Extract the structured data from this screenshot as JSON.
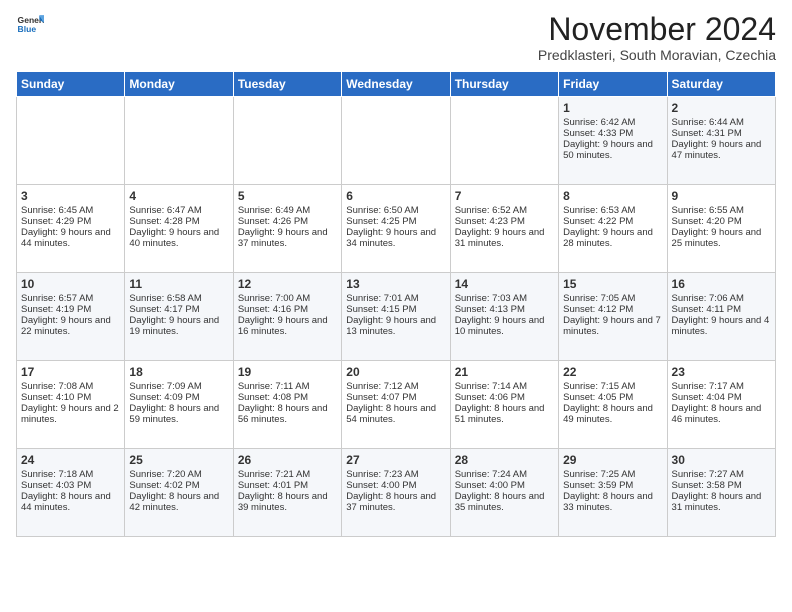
{
  "header": {
    "logo_line1": "General",
    "logo_line2": "Blue",
    "month_year": "November 2024",
    "location": "Predklasteri, South Moravian, Czechia"
  },
  "weekdays": [
    "Sunday",
    "Monday",
    "Tuesday",
    "Wednesday",
    "Thursday",
    "Friday",
    "Saturday"
  ],
  "weeks": [
    [
      {
        "day": "",
        "text": ""
      },
      {
        "day": "",
        "text": ""
      },
      {
        "day": "",
        "text": ""
      },
      {
        "day": "",
        "text": ""
      },
      {
        "day": "",
        "text": ""
      },
      {
        "day": "1",
        "text": "Sunrise: 6:42 AM\nSunset: 4:33 PM\nDaylight: 9 hours and 50 minutes."
      },
      {
        "day": "2",
        "text": "Sunrise: 6:44 AM\nSunset: 4:31 PM\nDaylight: 9 hours and 47 minutes."
      }
    ],
    [
      {
        "day": "3",
        "text": "Sunrise: 6:45 AM\nSunset: 4:29 PM\nDaylight: 9 hours and 44 minutes."
      },
      {
        "day": "4",
        "text": "Sunrise: 6:47 AM\nSunset: 4:28 PM\nDaylight: 9 hours and 40 minutes."
      },
      {
        "day": "5",
        "text": "Sunrise: 6:49 AM\nSunset: 4:26 PM\nDaylight: 9 hours and 37 minutes."
      },
      {
        "day": "6",
        "text": "Sunrise: 6:50 AM\nSunset: 4:25 PM\nDaylight: 9 hours and 34 minutes."
      },
      {
        "day": "7",
        "text": "Sunrise: 6:52 AM\nSunset: 4:23 PM\nDaylight: 9 hours and 31 minutes."
      },
      {
        "day": "8",
        "text": "Sunrise: 6:53 AM\nSunset: 4:22 PM\nDaylight: 9 hours and 28 minutes."
      },
      {
        "day": "9",
        "text": "Sunrise: 6:55 AM\nSunset: 4:20 PM\nDaylight: 9 hours and 25 minutes."
      }
    ],
    [
      {
        "day": "10",
        "text": "Sunrise: 6:57 AM\nSunset: 4:19 PM\nDaylight: 9 hours and 22 minutes."
      },
      {
        "day": "11",
        "text": "Sunrise: 6:58 AM\nSunset: 4:17 PM\nDaylight: 9 hours and 19 minutes."
      },
      {
        "day": "12",
        "text": "Sunrise: 7:00 AM\nSunset: 4:16 PM\nDaylight: 9 hours and 16 minutes."
      },
      {
        "day": "13",
        "text": "Sunrise: 7:01 AM\nSunset: 4:15 PM\nDaylight: 9 hours and 13 minutes."
      },
      {
        "day": "14",
        "text": "Sunrise: 7:03 AM\nSunset: 4:13 PM\nDaylight: 9 hours and 10 minutes."
      },
      {
        "day": "15",
        "text": "Sunrise: 7:05 AM\nSunset: 4:12 PM\nDaylight: 9 hours and 7 minutes."
      },
      {
        "day": "16",
        "text": "Sunrise: 7:06 AM\nSunset: 4:11 PM\nDaylight: 9 hours and 4 minutes."
      }
    ],
    [
      {
        "day": "17",
        "text": "Sunrise: 7:08 AM\nSunset: 4:10 PM\nDaylight: 9 hours and 2 minutes."
      },
      {
        "day": "18",
        "text": "Sunrise: 7:09 AM\nSunset: 4:09 PM\nDaylight: 8 hours and 59 minutes."
      },
      {
        "day": "19",
        "text": "Sunrise: 7:11 AM\nSunset: 4:08 PM\nDaylight: 8 hours and 56 minutes."
      },
      {
        "day": "20",
        "text": "Sunrise: 7:12 AM\nSunset: 4:07 PM\nDaylight: 8 hours and 54 minutes."
      },
      {
        "day": "21",
        "text": "Sunrise: 7:14 AM\nSunset: 4:06 PM\nDaylight: 8 hours and 51 minutes."
      },
      {
        "day": "22",
        "text": "Sunrise: 7:15 AM\nSunset: 4:05 PM\nDaylight: 8 hours and 49 minutes."
      },
      {
        "day": "23",
        "text": "Sunrise: 7:17 AM\nSunset: 4:04 PM\nDaylight: 8 hours and 46 minutes."
      }
    ],
    [
      {
        "day": "24",
        "text": "Sunrise: 7:18 AM\nSunset: 4:03 PM\nDaylight: 8 hours and 44 minutes."
      },
      {
        "day": "25",
        "text": "Sunrise: 7:20 AM\nSunset: 4:02 PM\nDaylight: 8 hours and 42 minutes."
      },
      {
        "day": "26",
        "text": "Sunrise: 7:21 AM\nSunset: 4:01 PM\nDaylight: 8 hours and 39 minutes."
      },
      {
        "day": "27",
        "text": "Sunrise: 7:23 AM\nSunset: 4:00 PM\nDaylight: 8 hours and 37 minutes."
      },
      {
        "day": "28",
        "text": "Sunrise: 7:24 AM\nSunset: 4:00 PM\nDaylight: 8 hours and 35 minutes."
      },
      {
        "day": "29",
        "text": "Sunrise: 7:25 AM\nSunset: 3:59 PM\nDaylight: 8 hours and 33 minutes."
      },
      {
        "day": "30",
        "text": "Sunrise: 7:27 AM\nSunset: 3:58 PM\nDaylight: 8 hours and 31 minutes."
      }
    ]
  ]
}
